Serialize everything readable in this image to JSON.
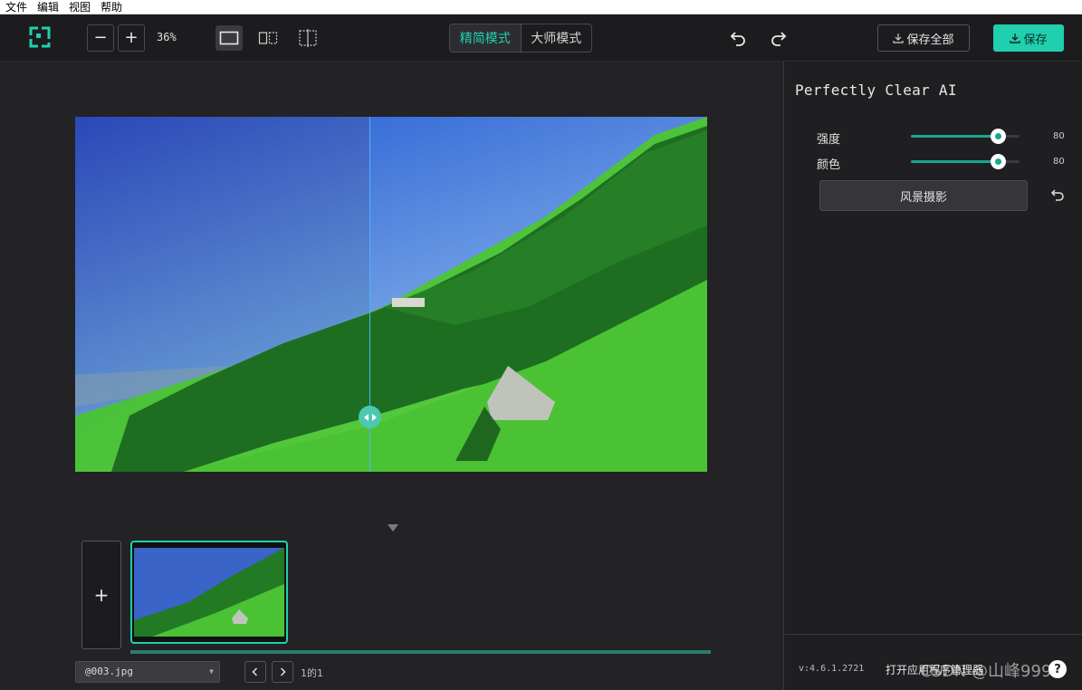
{
  "menu": [
    "文件",
    "编辑",
    "视图",
    "帮助"
  ],
  "toolbar": {
    "zoom_out_label": "−",
    "zoom_in_label": "+",
    "zoom_level": "36%",
    "modes": [
      "精简模式",
      "大师模式"
    ],
    "active_mode": "精简模式",
    "save_all_label": "保存全部",
    "save_label": "保存"
  },
  "filmstrip": {
    "add_label": "+",
    "file_name": "@003.jpg",
    "page_info": "1的1"
  },
  "panel": {
    "title": "Perfectly Clear AI",
    "sliders": [
      {
        "label": "强度",
        "value": "80",
        "level": 80
      },
      {
        "label": "颜色",
        "value": "80",
        "level": 80
      }
    ],
    "preset_label": "风景摄影",
    "version": "v:4.6.1.2721",
    "open_manager": "打开应用程序管理器",
    "watermark": "CSDN @山峰999",
    "help_label": "?"
  },
  "colors": {
    "accent": "#1fcfae",
    "slider_fill": "#1aa68f",
    "divider": "#4fb3ff"
  },
  "icons": [
    "app-logo-icon",
    "single-view-icon",
    "split-view-icon",
    "crop-view-icon",
    "undo-icon",
    "redo-icon",
    "download-icon",
    "reset-icon",
    "chevron-left-icon",
    "chevron-right-icon",
    "collapse-arrow-icon"
  ]
}
